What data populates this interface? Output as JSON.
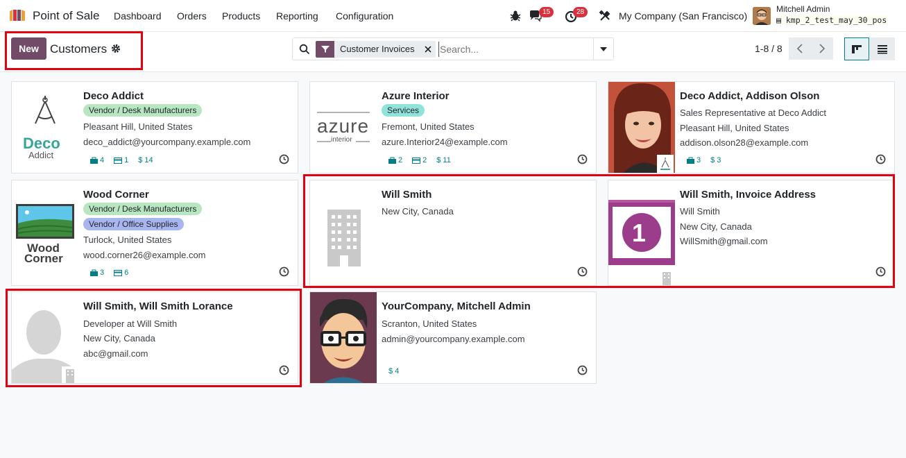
{
  "nav": {
    "app_name": "Point of Sale",
    "menu": [
      "Dashboard",
      "Orders",
      "Products",
      "Reporting",
      "Configuration"
    ],
    "messages_count": "15",
    "activities_count": "28",
    "company": "My Company (San Francisco)",
    "user_name": "Mitchell Admin",
    "db_name": "kmp_2_test_may_30_pos"
  },
  "control": {
    "new_label": "New",
    "title": "Customers",
    "facet_label": "Customer Invoices",
    "search_placeholder": "Search...",
    "pager": "1-8 / 8"
  },
  "colors": {
    "brand": "#714b67",
    "accent": "#017e84",
    "highlight": "#e3000f"
  },
  "cards": [
    {
      "name": "Deco Addict",
      "tags": [
        {
          "label": "Vendor / Desk Manufacturers",
          "color": "#b8e6c1"
        }
      ],
      "lines": [
        "Pleasant Hill, United States",
        "deco_addict@yourcompany.example.com"
      ],
      "stats": [
        {
          "icon": "bag-icon",
          "value": "4"
        },
        {
          "icon": "card-icon",
          "value": "1"
        },
        {
          "icon": "dollar-icon",
          "value": "$ 14"
        }
      ],
      "image": "deco-addict-logo",
      "logo_text": [
        "Deco",
        "Addict"
      ]
    },
    {
      "name": "Azure Interior",
      "tags": [
        {
          "label": "Services",
          "color": "#8fe3da"
        }
      ],
      "lines": [
        "Fremont, United States",
        "azure.Interior24@example.com"
      ],
      "stats": [
        {
          "icon": "bag-icon",
          "value": "2"
        },
        {
          "icon": "card-icon",
          "value": "2"
        },
        {
          "icon": "dollar-icon",
          "value": "$ 11"
        }
      ],
      "image": "azure-interior-logo",
      "logo_text": [
        "azure",
        "interior"
      ]
    },
    {
      "name": "Deco Addict, Addison Olson",
      "tags": [],
      "lines": [
        "Sales Representative at Deco Addict",
        "Pleasant Hill, United States",
        "addison.olson28@example.com"
      ],
      "stats": [
        {
          "icon": "bag-icon",
          "value": "3"
        },
        {
          "icon": "dollar-icon",
          "value": "$ 3"
        }
      ],
      "image": "person-photo",
      "logo_text": []
    },
    {
      "name": "Wood Corner",
      "tags": [
        {
          "label": "Vendor / Desk Manufacturers",
          "color": "#b8e6c1"
        },
        {
          "label": "Vendor / Office Supplies",
          "color": "#a8b6f0"
        }
      ],
      "lines": [
        "Turlock, United States",
        "wood.corner26@example.com"
      ],
      "stats": [
        {
          "icon": "bag-icon",
          "value": "3"
        },
        {
          "icon": "card-icon",
          "value": "6"
        }
      ],
      "image": "wood-corner-logo",
      "logo_text": [
        "Wood",
        "Corner"
      ]
    },
    {
      "name": "Will Smith",
      "tags": [],
      "lines": [
        "New City, Canada"
      ],
      "stats": [],
      "image": "building-placeholder",
      "logo_text": []
    },
    {
      "name": "Will Smith, Invoice Address",
      "tags": [],
      "lines": [
        "Will Smith",
        "New City, Canada",
        "WillSmith@gmail.com"
      ],
      "stats": [],
      "image": "invoice-number-image",
      "logo_text": [
        "1"
      ]
    },
    {
      "name": "Will Smith, Will Smith Lorance",
      "tags": [],
      "lines": [
        "Developer at Will Smith",
        "New City, Canada",
        "abc@gmail.com"
      ],
      "stats": [],
      "image": "person-placeholder",
      "logo_text": []
    },
    {
      "name": "YourCompany, Mitchell Admin",
      "tags": [],
      "lines": [
        "Scranton, United States",
        "admin@yourcompany.example.com"
      ],
      "stats": [
        {
          "icon": "dollar-icon",
          "value": "$ 4"
        }
      ],
      "image": "cartoon-avatar",
      "logo_text": []
    }
  ]
}
